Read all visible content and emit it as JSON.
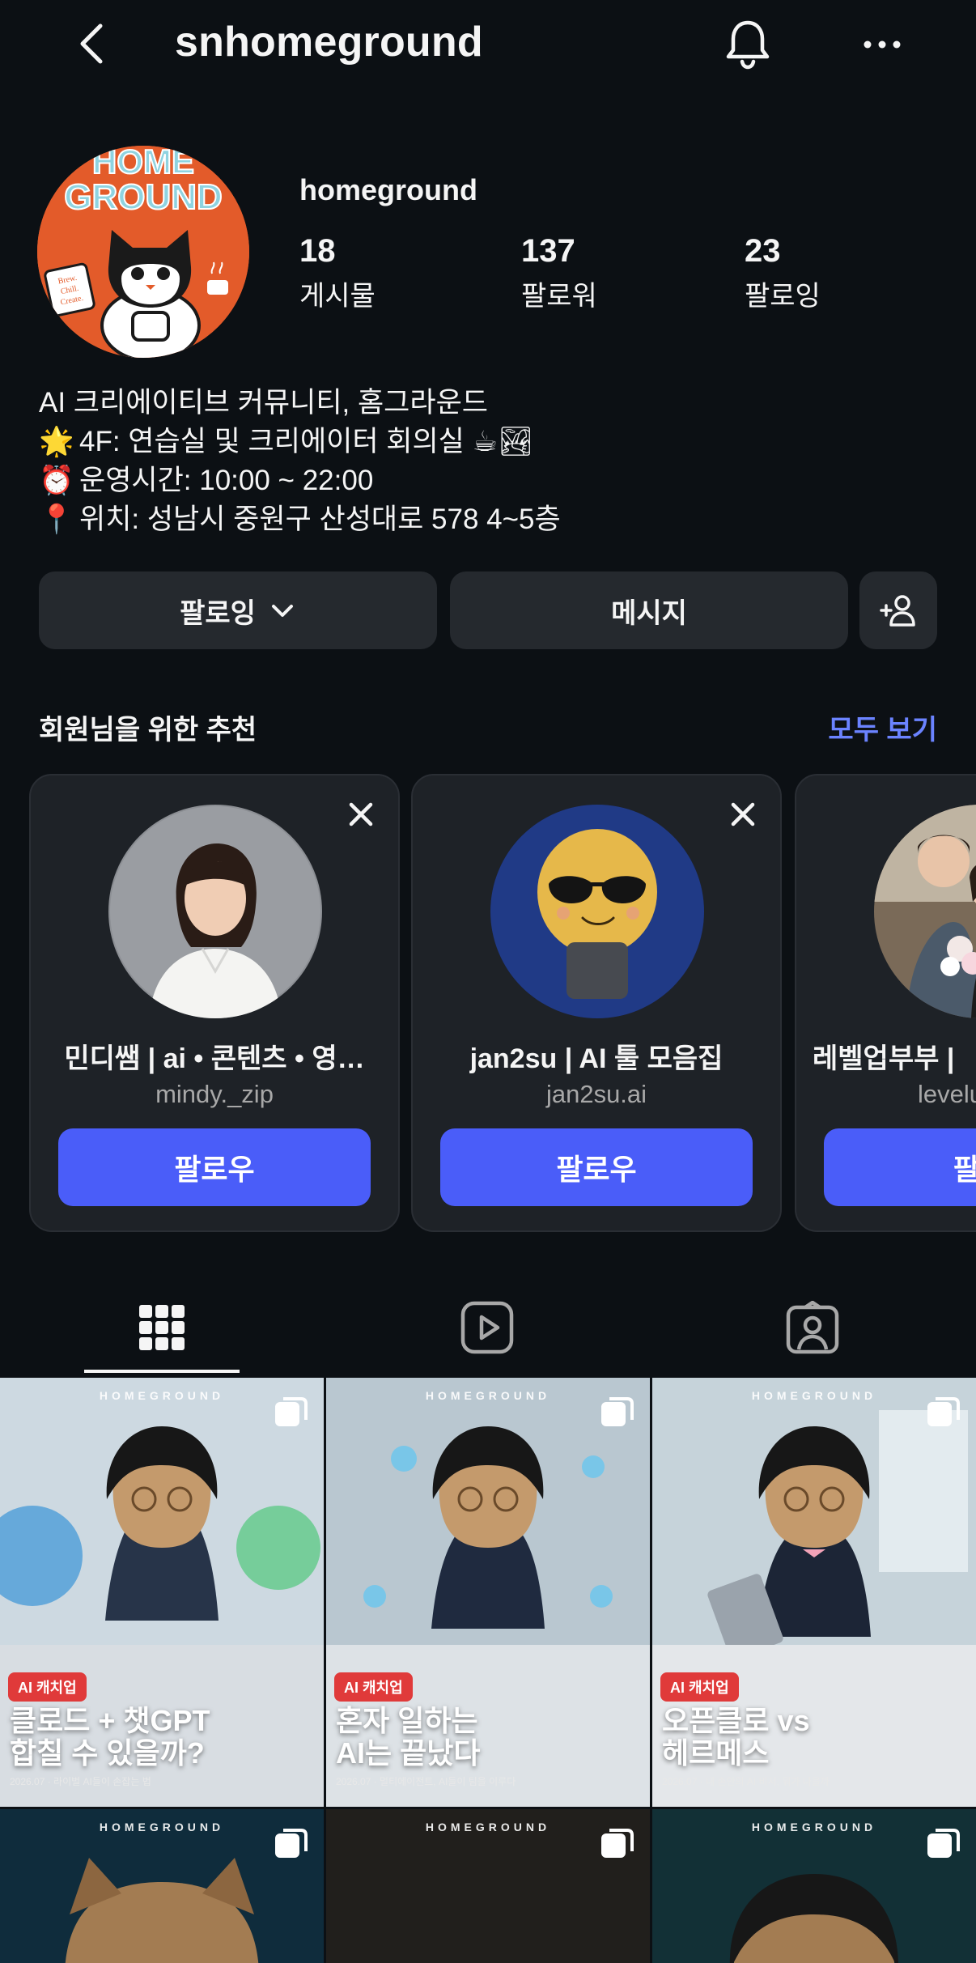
{
  "topbar": {
    "username": "snhomeground"
  },
  "profile": {
    "avatar_text_lines": [
      "HOME",
      "GROUND"
    ],
    "avatar_badge": [
      "Brew.",
      "Chill.",
      "Create."
    ],
    "display_name": "homeground",
    "stats": [
      {
        "value": "18",
        "label": "게시물"
      },
      {
        "value": "137",
        "label": "팔로워"
      },
      {
        "value": "23",
        "label": "팔로잉"
      }
    ],
    "bio": [
      {
        "emoji": "",
        "text": "AI 크리에이티브 커뮤니티, 홈그라운드"
      },
      {
        "emoji": "🌟",
        "text": "4F: 연습실 및 크리에이터 회의실 ☕🏞"
      },
      {
        "emoji": "⏰",
        "text": "운영시간: 10:00 ~ 22:00"
      },
      {
        "emoji": "📍",
        "text": "위치: 성남시 중원구 산성대로 578 4~5층"
      }
    ]
  },
  "actions": {
    "following_label": "팔로잉",
    "message_label": "메시지"
  },
  "suggestions": {
    "title": "회원님을 위한 추천",
    "see_all": "모두 보기",
    "cards": [
      {
        "name": "민디쌤 | ai • 콘텐츠 • 영…",
        "handle": "mindy._zip",
        "follow": "팔로우"
      },
      {
        "name": "jan2su | AI 툴 모음집",
        "handle": "jan2su.ai",
        "follow": "팔로우"
      },
      {
        "name": "레벨업부부 |",
        "handle": "levelup",
        "follow": "팔로"
      }
    ]
  },
  "posts": [
    {
      "brand": "HOMEGROUND",
      "tag": "AI 캐치업",
      "headline": [
        "클로드 + 챗GPT",
        "합칠 수 있을까?"
      ],
      "caption": "2026.07 · 라이벌 AI들이 손잡는 법"
    },
    {
      "brand": "HOMEGROUND",
      "tag": "AI 캐치업",
      "headline": [
        "혼자 일하는",
        "AI는 끝났다"
      ],
      "caption": "2026.07 · 멀티에이전트, AI들이 팀을 이루다"
    },
    {
      "brand": "HOMEGROUND",
      "tag": "AI 캐치업",
      "headline": [
        "오픈클로 vs",
        "헤르메스"
      ],
      "caption": "2026.07 · 내 손안의 AI 비서, 뭐가 나을까"
    },
    {
      "brand": "HOMEGROUND"
    },
    {
      "brand": "HOMEGROUND"
    },
    {
      "brand": "HOMEGROUND"
    }
  ],
  "colors": {
    "background": "#0c1014",
    "button": "#25292e",
    "accent": "#4a5df9",
    "link": "#6b83ff",
    "tag": "#e03a3a"
  }
}
